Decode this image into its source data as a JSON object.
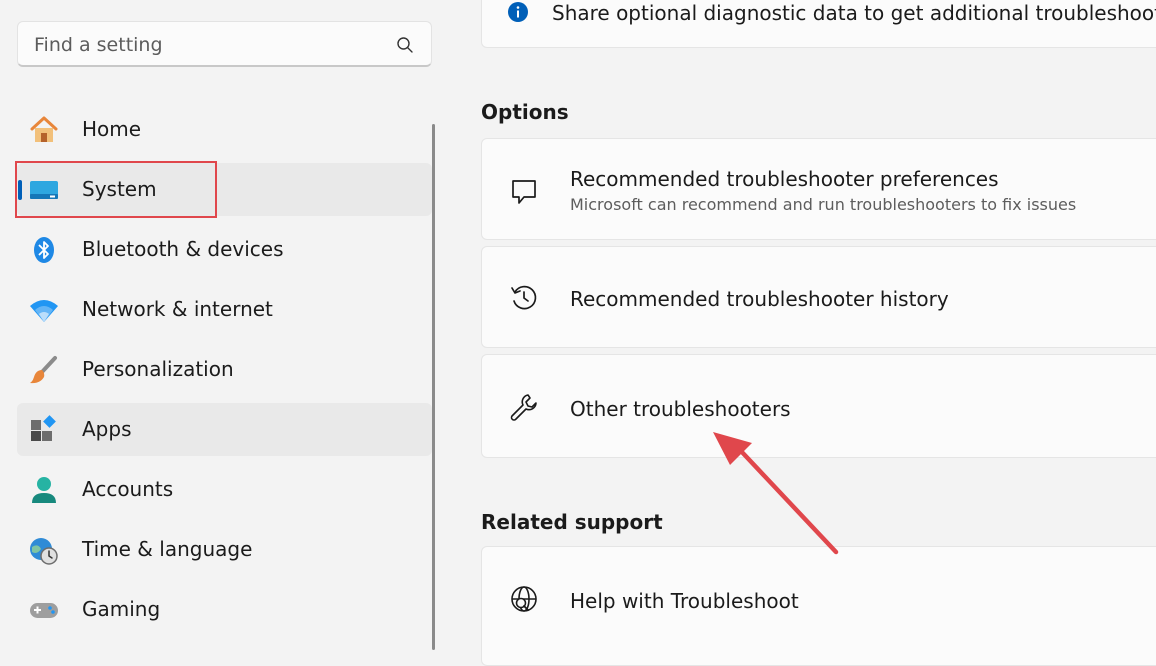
{
  "sidebar": {
    "search": {
      "placeholder": "Find a setting",
      "icon": "search-icon"
    },
    "items": [
      {
        "label": "Home",
        "icon": "home-icon"
      },
      {
        "label": "System",
        "icon": "system-display-icon",
        "selected": true
      },
      {
        "label": "Bluetooth & devices",
        "icon": "bluetooth-icon"
      },
      {
        "label": "Network & internet",
        "icon": "wifi-icon"
      },
      {
        "label": "Personalization",
        "icon": "paintbrush-icon"
      },
      {
        "label": "Apps",
        "icon": "apps-icon"
      },
      {
        "label": "Accounts",
        "icon": "account-icon"
      },
      {
        "label": "Time & language",
        "icon": "clock-globe-icon"
      },
      {
        "label": "Gaming",
        "icon": "gamepad-icon"
      }
    ]
  },
  "main": {
    "top_card": {
      "text": "Share optional diagnostic data to get additional troubleshooting",
      "icon": "info-icon"
    },
    "options": {
      "heading": "Options",
      "cards": [
        {
          "title": "Recommended troubleshooter preferences",
          "description": "Microsoft can recommend and run troubleshooters to fix issues",
          "icon": "chat-bubble-icon"
        },
        {
          "title": "Recommended troubleshooter history",
          "icon": "history-icon"
        },
        {
          "title": "Other troubleshooters",
          "icon": "wrench-icon"
        }
      ]
    },
    "related": {
      "heading": "Related support",
      "cards": [
        {
          "title": "Help with Troubleshoot",
          "icon": "globe-search-icon"
        }
      ]
    }
  },
  "colors": {
    "accent": "#005fb8",
    "annotation_red": "#e0474c",
    "background": "#f3f3f3",
    "card": "#fbfbfb"
  }
}
